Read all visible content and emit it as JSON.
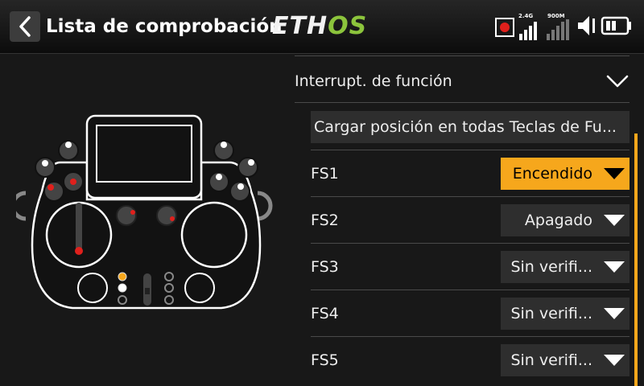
{
  "header": {
    "title": "Lista de comprobación",
    "logo_left": "ETH",
    "logo_right": "OS",
    "status": {
      "record_icon": "record-icon",
      "rssi_24_label": "2.4G",
      "rssi_900_label": "900M",
      "volume_icon": "speaker-icon",
      "battery_icon": "battery-icon",
      "accent": "#e0201c"
    }
  },
  "section": {
    "label": "Interrupt. de función",
    "expanded": true
  },
  "load_button": {
    "label": "Cargar posición en todas Teclas de Fu..."
  },
  "rows": [
    {
      "label": "FS1",
      "value": "Encendido",
      "highlighted": true
    },
    {
      "label": "FS2",
      "value": "Apagado",
      "highlighted": false
    },
    {
      "label": "FS3",
      "value": "Sin verifi...",
      "highlighted": false
    },
    {
      "label": "FS4",
      "value": "Sin verifi...",
      "highlighted": false
    },
    {
      "label": "FS5",
      "value": "Sin verifi...",
      "highlighted": false
    }
  ],
  "colors": {
    "accent": "#f6a71c",
    "logo_green": "#8cc43c",
    "alert_red": "#e0201c"
  }
}
